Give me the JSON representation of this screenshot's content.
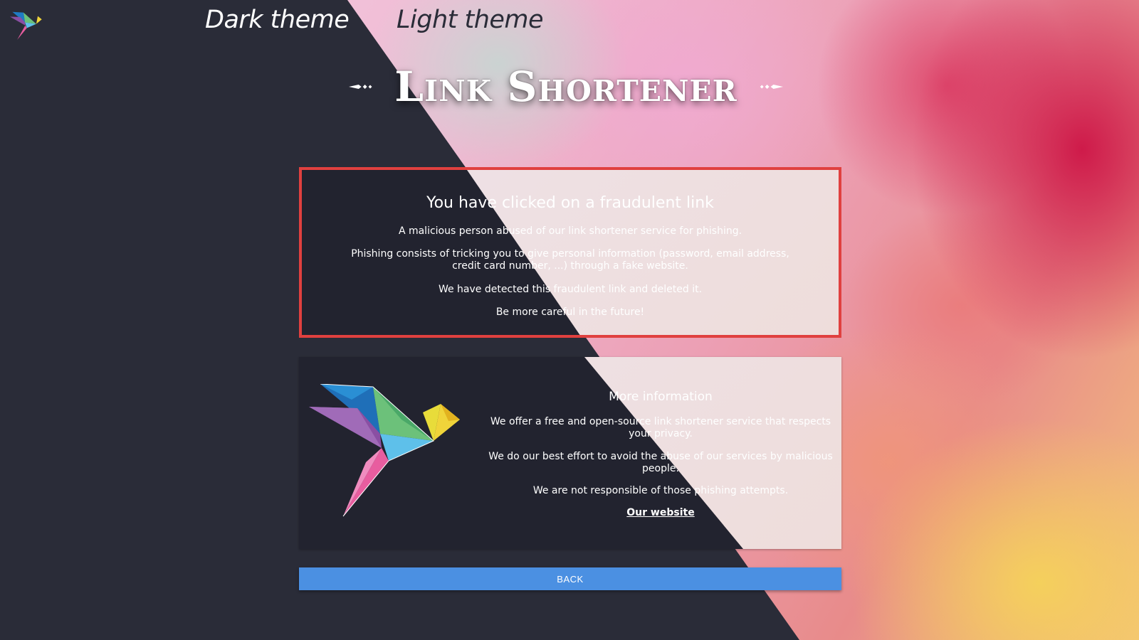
{
  "header": {
    "logo_icon": "hummingbird-logo-icon",
    "theme_dark_label": "Dark theme",
    "theme_light_label": "Light theme"
  },
  "title": "Link Shortener",
  "alert": {
    "heading": "You have clicked on a fraudulent link",
    "paragraphs": [
      "A malicious person abused of our link shortener service for phishing.",
      "Phishing consists of tricking you to give personal information (password, email address, credit card number, ...) through a fake website.",
      "We have detected this fraudulent link and deleted it.",
      "Be more careful in the future!"
    ],
    "border_color": "#e0403f"
  },
  "info": {
    "illustration_icon": "origami-hummingbird-icon",
    "heading": "More information",
    "paragraphs": [
      "We offer a free and open-source link shortener service that respects your privacy.",
      "We do our best effort to avoid the abuse of our services by malicious people.",
      "We are not responsible of those phishing attempts."
    ],
    "website_link": "Our website"
  },
  "back_button": "BACK",
  "colors": {
    "dark_bg": "#2a2c38",
    "card_dark": "#22232f",
    "accent_blue": "#4b90e2"
  }
}
